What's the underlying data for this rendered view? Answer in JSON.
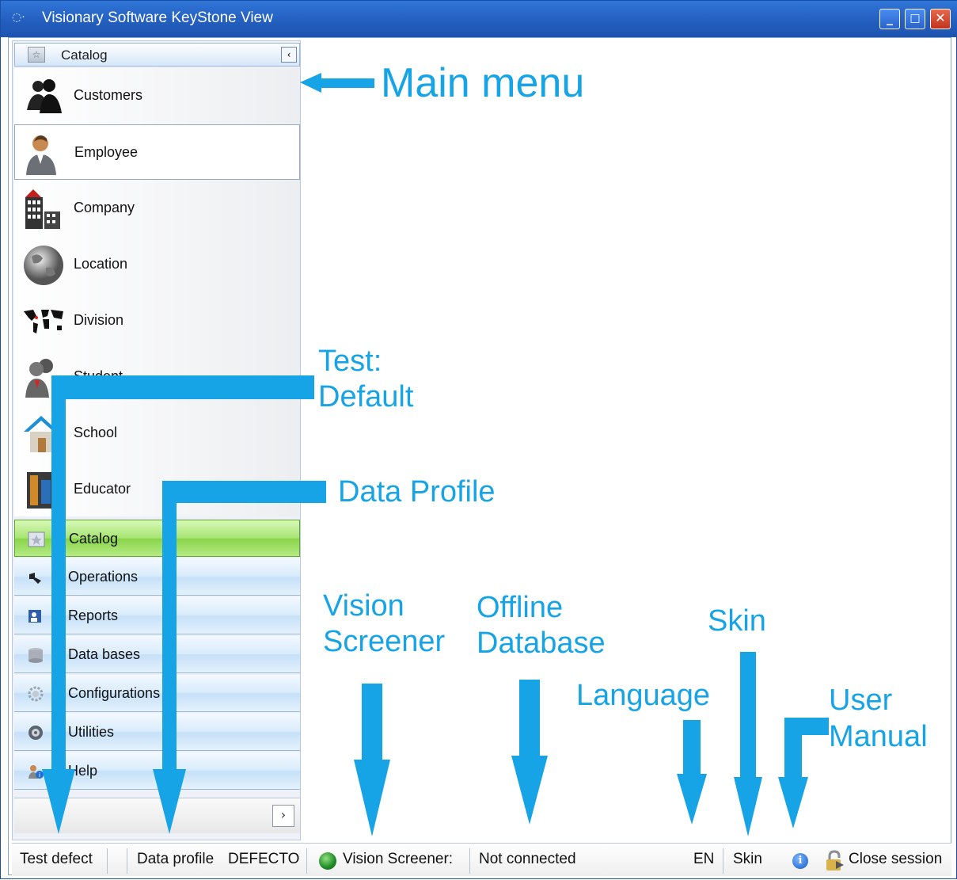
{
  "window": {
    "title": "Visionary Software KeyStone View",
    "controls": {
      "minimize": "_",
      "maximize": "□",
      "close": "✕"
    }
  },
  "nav": {
    "header": "Catalog",
    "collapse_glyph": "‹",
    "items": [
      {
        "label": "Customers",
        "icon": "customers-icon"
      },
      {
        "label": "Employee",
        "icon": "employee-icon",
        "selected": true
      },
      {
        "label": "Company",
        "icon": "company-icon"
      },
      {
        "label": "Location",
        "icon": "globe-icon"
      },
      {
        "label": "Division",
        "icon": "world-map-icon"
      },
      {
        "label": "Student",
        "icon": "student-icon"
      },
      {
        "label": "School",
        "icon": "school-icon"
      },
      {
        "label": "Educator",
        "icon": "educator-icon"
      }
    ],
    "groups": [
      {
        "label": "Catalog",
        "active": true
      },
      {
        "label": "Operations"
      },
      {
        "label": "Reports"
      },
      {
        "label": "Data bases"
      },
      {
        "label": "Configurations"
      },
      {
        "label": "Utilities"
      },
      {
        "label": "Help"
      }
    ],
    "footer_glyph": "›"
  },
  "statusbar": {
    "test": "Test defect",
    "data_profile_label": "Data profile",
    "data_profile_value": "DEFECTO",
    "vision_screener": "Vision Screener:",
    "connection": "Not connected",
    "language": "EN",
    "skin": "Skin",
    "info_glyph": "i",
    "close_session": "Close session"
  },
  "annotations": {
    "main_menu": "Main menu",
    "test_default": [
      "Test:",
      "Default"
    ],
    "data_profile": "Data Profile",
    "vision_screener": [
      "Vision",
      "Screener"
    ],
    "offline_database": [
      "Offline",
      "Database"
    ],
    "language": "Language",
    "skin": "Skin",
    "user_manual": [
      "User",
      "Manual"
    ]
  },
  "colors": {
    "annotation": "#17a4e6",
    "title_bar": "#245fbf",
    "active_group": "#89d44a"
  }
}
